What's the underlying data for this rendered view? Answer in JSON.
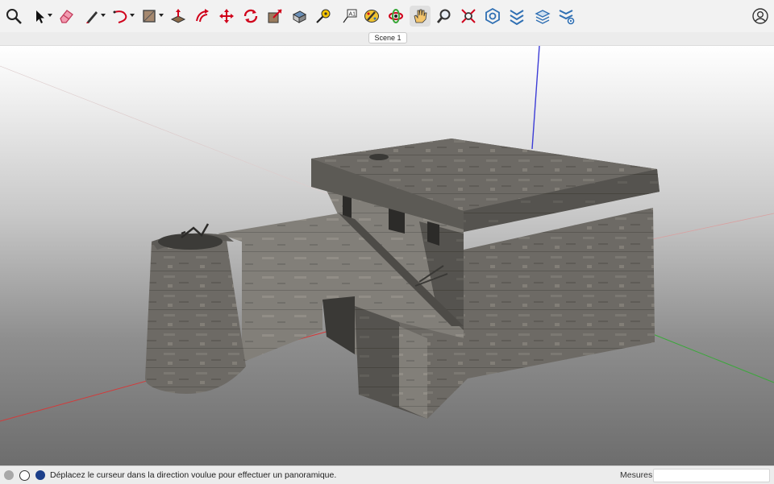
{
  "toolbar": {
    "tools": [
      {
        "name": "zoom-window-icon"
      },
      {
        "name": "select-arrow-icon"
      },
      {
        "name": "eraser-icon"
      },
      {
        "name": "pencil-line-icon"
      },
      {
        "name": "arc-icon"
      },
      {
        "name": "rectangle-shape-icon"
      },
      {
        "name": "push-pull-icon"
      },
      {
        "name": "offset-icon"
      },
      {
        "name": "move-icon"
      },
      {
        "name": "rotate-icon"
      },
      {
        "name": "scale-icon"
      },
      {
        "name": "paint-bucket-icon"
      },
      {
        "name": "tape-measure-icon"
      },
      {
        "name": "text-label-icon"
      },
      {
        "name": "paint-palette-icon"
      },
      {
        "name": "orbit-icon"
      },
      {
        "name": "pan-hand-icon"
      },
      {
        "name": "zoom-magnifier-icon"
      },
      {
        "name": "zoom-extents-icon"
      },
      {
        "name": "components-icon"
      },
      {
        "name": "tags-icon"
      },
      {
        "name": "scenes-icon"
      },
      {
        "name": "styles-settings-icon"
      }
    ],
    "account_icon": "user-account-icon"
  },
  "scenes": {
    "active_tab": "Scene 1"
  },
  "status": {
    "message": "Déplacez le curseur dans la direction voulue pour effectuer un panoramique.",
    "mesures_label": "Mesures",
    "mesures_value": ""
  },
  "colors": {
    "accent_red": "#d0021b",
    "accent_blue": "#2f6fb3",
    "axis_red": "#d33a3a",
    "axis_green": "#3aa83a",
    "axis_blue": "#3c3cd6"
  }
}
